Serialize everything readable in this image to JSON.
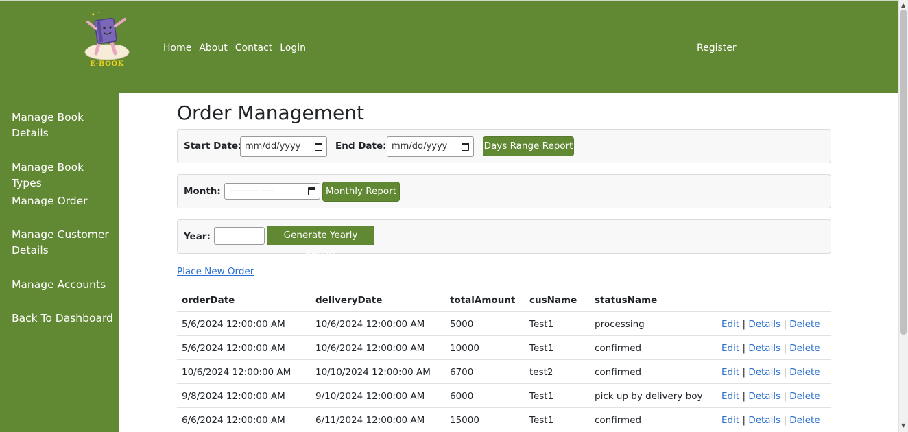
{
  "brand": {
    "logo_text": "E-BOOK"
  },
  "nav": {
    "items": [
      "Home",
      "About",
      "Contact",
      "Login"
    ],
    "register": "Register"
  },
  "sidebar": {
    "items": [
      "Manage Book Details",
      "Manage Book Types",
      "Manage Order",
      "Manage Customer Details",
      "Manage Accounts",
      "Back To Dashboard"
    ]
  },
  "page": {
    "title": "Order Management",
    "days_range": {
      "start_label": "Start Date:",
      "start_value": "mm/dd/yyyy",
      "end_label": "End Date:",
      "end_value": "mm/dd/yyyy",
      "button": "Days Range Report"
    },
    "monthly": {
      "label": "Month:",
      "value": "--------- ----",
      "button": "Monthly Report"
    },
    "yearly": {
      "label": "Year:",
      "value": "",
      "button": "Generate Yearly Report"
    },
    "place_order_link": "Place New Order"
  },
  "table": {
    "columns": [
      "orderDate",
      "deliveryDate",
      "totalAmount",
      "cusName",
      "statusName"
    ],
    "actions": {
      "edit": "Edit",
      "details": "Details",
      "delete": "Delete",
      "separator": "|"
    },
    "rows": [
      {
        "orderDate": "5/6/2024 12:00:00 AM",
        "deliveryDate": "10/6/2024 12:00:00 AM",
        "totalAmount": "5000",
        "cusName": "Test1",
        "statusName": "processing"
      },
      {
        "orderDate": "5/6/2024 12:00:00 AM",
        "deliveryDate": "10/6/2024 12:00:00 AM",
        "totalAmount": "10000",
        "cusName": "Test1",
        "statusName": "confirmed"
      },
      {
        "orderDate": "10/6/2024 12:00:00 AM",
        "deliveryDate": "10/10/2024 12:00:00 AM",
        "totalAmount": "6700",
        "cusName": "test2",
        "statusName": "confirmed"
      },
      {
        "orderDate": "9/8/2024 12:00:00 AM",
        "deliveryDate": "9/10/2024 12:00:00 AM",
        "totalAmount": "6000",
        "cusName": "Test1",
        "statusName": "pick up by delivery boy"
      },
      {
        "orderDate": "6/6/2024 12:00:00 AM",
        "deliveryDate": "6/11/2024 12:00:00 AM",
        "totalAmount": "15000",
        "cusName": "Test1",
        "statusName": "confirmed"
      }
    ]
  },
  "colors": {
    "brand_green": "#618833",
    "link_blue": "#2a6fcf",
    "logo_yellow": "#f4d21f"
  }
}
